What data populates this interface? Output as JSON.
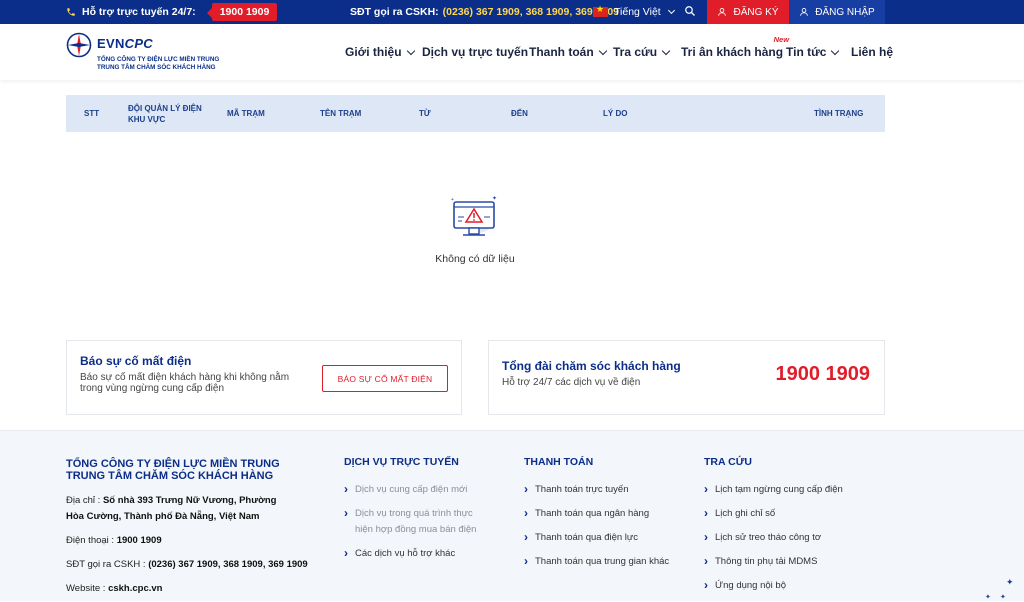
{
  "topbar": {
    "hotline_label": "Hỗ trợ trực tuyến 24/7:",
    "hotline_number": "1900 1909",
    "cskh_label": "SĐT gọi ra CSKH:",
    "cskh_numbers": "(0236) 367 1909, 368 1909, 369 1909",
    "language": "Tiếng Việt",
    "register": "ĐĂNG KÝ",
    "login": "ĐĂNG NHẬP"
  },
  "logo": {
    "brand_evn": "EVN",
    "brand_cpc": "CPC",
    "sub1": "TỔNG CÔNG TY ĐIỆN LỰC MIỀN TRUNG",
    "sub2": "TRUNG TÂM CHĂM SÓC KHÁCH HÀNG"
  },
  "nav": {
    "items": [
      {
        "label": "Giới thiệu"
      },
      {
        "label": "Dịch vụ trực tuyến"
      },
      {
        "label": "Thanh toán"
      },
      {
        "label": "Tra cứu"
      },
      {
        "label": "Tri ân khách hàng",
        "badge": "New"
      },
      {
        "label": "Tin tức"
      },
      {
        "label": "Liên hệ"
      }
    ]
  },
  "table": {
    "headers": [
      "STT",
      "ĐỘI QUẢN LÝ ĐIỆN KHU VỰC",
      "MÃ TRẠM",
      "TÊN TRẠM",
      "TỪ",
      "ĐẾN",
      "LÝ DO",
      "TÌNH TRẠNG"
    ],
    "empty_message": "Không có dữ liệu"
  },
  "report_card": {
    "title": "Báo sự cố mất điện",
    "desc": "Báo sự cố mất điện khách hàng khi không nằm trong vùng ngừng cung cấp điện",
    "button": "BÁO SỰ CỐ MẤT ĐIỆN"
  },
  "call_card": {
    "title": "Tổng đài chăm sóc khách hàng",
    "desc": "Hỗ trợ 24/7 các dịch vụ về điện",
    "phone": "1900 1909"
  },
  "footer": {
    "org_line1": "TỔNG CÔNG TY ĐIỆN LỰC MIỀN TRUNG",
    "org_line2": "TRUNG TÂM CHĂM SÓC KHÁCH HÀNG",
    "address_label": "Địa chỉ :",
    "address": "Số nhà 393 Trưng Nữ Vương, Phường Hòa Cường, Thành phố Đà Nẵng, Việt Nam",
    "phone_label": "Điện thoại :",
    "phone": "1900 1909",
    "cskh_label": "SĐT gọi ra CSKH :",
    "cskh": "(0236) 367 1909, 368 1909, 369 1909",
    "website_label": "Website :",
    "website": "cskh.cpc.vn",
    "col_online": {
      "title": "DỊCH VỤ TRỰC TUYẾN",
      "links": [
        "Dịch vụ cung cấp điện mới",
        "Dịch vụ trong quá trình thực hiện hợp đồng mua bán điện",
        "Các dịch vụ hỗ trợ khác"
      ]
    },
    "col_payment": {
      "title": "THANH TOÁN",
      "links": [
        "Thanh toán trực tuyến",
        "Thanh toán qua ngân hàng",
        "Thanh toán qua điện lực",
        "Thanh toán qua trung gian khác"
      ]
    },
    "col_lookup": {
      "title": "TRA CỨU",
      "links": [
        "Lịch tạm ngừng cung cấp điện",
        "Lịch ghi chỉ số",
        "Lịch sử treo tháo công tơ",
        "Thông tin phụ tải MDMS",
        "Ứng dụng nội bộ"
      ]
    }
  }
}
